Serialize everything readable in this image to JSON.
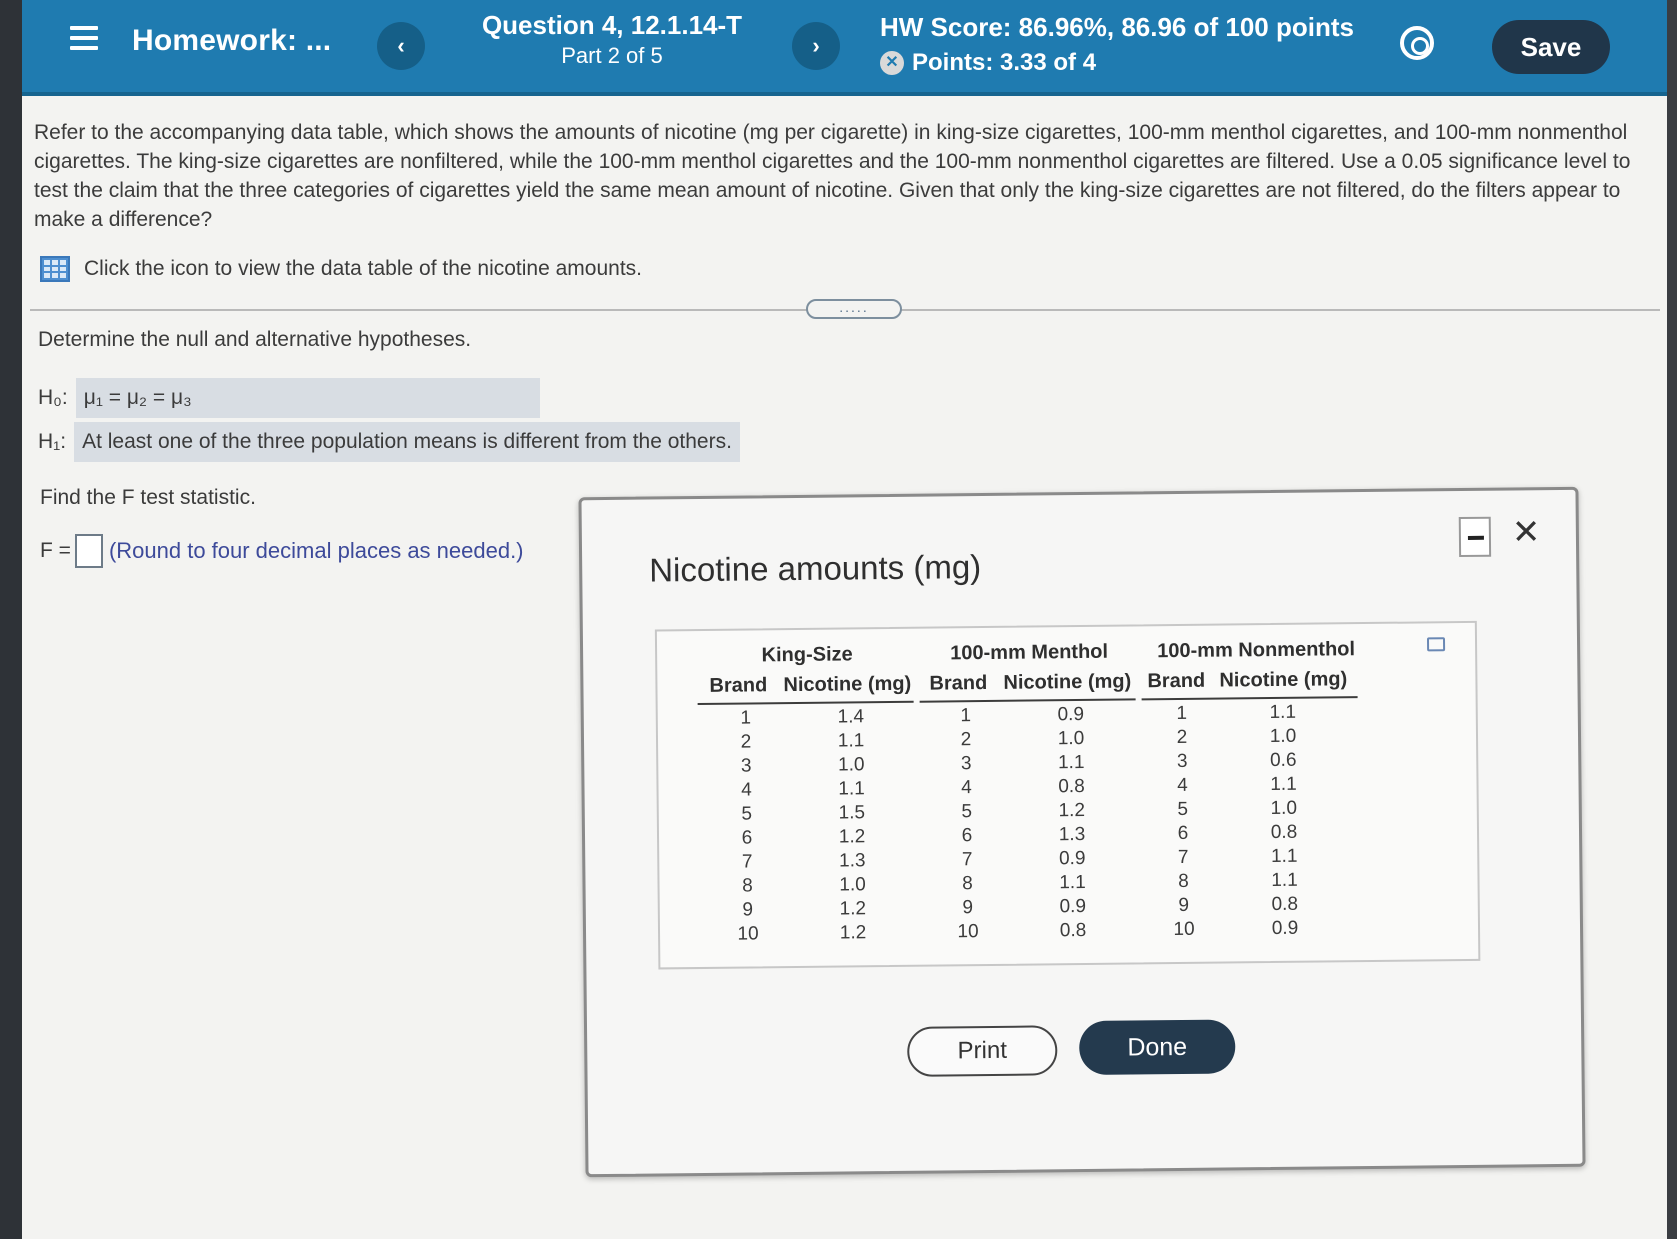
{
  "header": {
    "title": "Homework: ...",
    "question_title": "Question 4, 12.1.14-T",
    "question_part": "Part 2 of 5",
    "hw_score": "HW Score: 86.96%, 86.96 of 100 points",
    "points": "Points: 3.33 of 4",
    "save_label": "Save",
    "prev_symbol": "‹",
    "next_symbol": "›"
  },
  "question": {
    "text": "Refer to the accompanying data table, which shows the amounts of nicotine (mg per cigarette) in king-size cigarettes, 100-mm menthol cigarettes, and 100-mm nonmenthol cigarettes. The king-size cigarettes are nonfiltered, while the 100-mm menthol cigarettes and the 100-mm nonmenthol cigarettes are filtered. Use a 0.05 significance level to test the claim that the three categories of cigarettes yield the same mean amount of nicotine. Given that only the king-size cigarettes are not filtered, do the filters appear to make a difference?",
    "data_link": "Click the icon to view the data table of the nicotine amounts.",
    "handle": "....."
  },
  "hypotheses": {
    "prompt": "Determine the null and alternative hypotheses.",
    "h0_label": "H₀:",
    "h0_value": "μ₁ = μ₂ = μ₃",
    "h1_label": "H₁:",
    "h1_value": "At least one of the three population means is different from the others."
  },
  "f_test": {
    "prompt": "Find the F test statistic.",
    "label": "F =",
    "value": "",
    "note": "(Round to four decimal places as needed.)"
  },
  "modal": {
    "title": "Nicotine amounts (mg)",
    "print_label": "Print",
    "done_label": "Done",
    "close_symbol": "✕",
    "groups": [
      "King-Size",
      "100-mm Menthol",
      "100-mm Nonmenthol"
    ],
    "sub_brand": "Brand",
    "sub_nicotine": "Nicotine (mg)",
    "brands": [
      "1",
      "2",
      "3",
      "4",
      "5",
      "6",
      "7",
      "8",
      "9",
      "10"
    ],
    "king_size": [
      "1.4",
      "1.1",
      "1.0",
      "1.1",
      "1.5",
      "1.2",
      "1.3",
      "1.0",
      "1.2",
      "1.2"
    ],
    "menthol": [
      "0.9",
      "1.0",
      "1.1",
      "0.8",
      "1.2",
      "1.3",
      "0.9",
      "1.1",
      "0.9",
      "0.8"
    ],
    "nonmenthol": [
      "1.1",
      "1.0",
      "0.6",
      "1.1",
      "1.0",
      "0.8",
      "1.1",
      "1.1",
      "0.8",
      "0.9"
    ]
  }
}
